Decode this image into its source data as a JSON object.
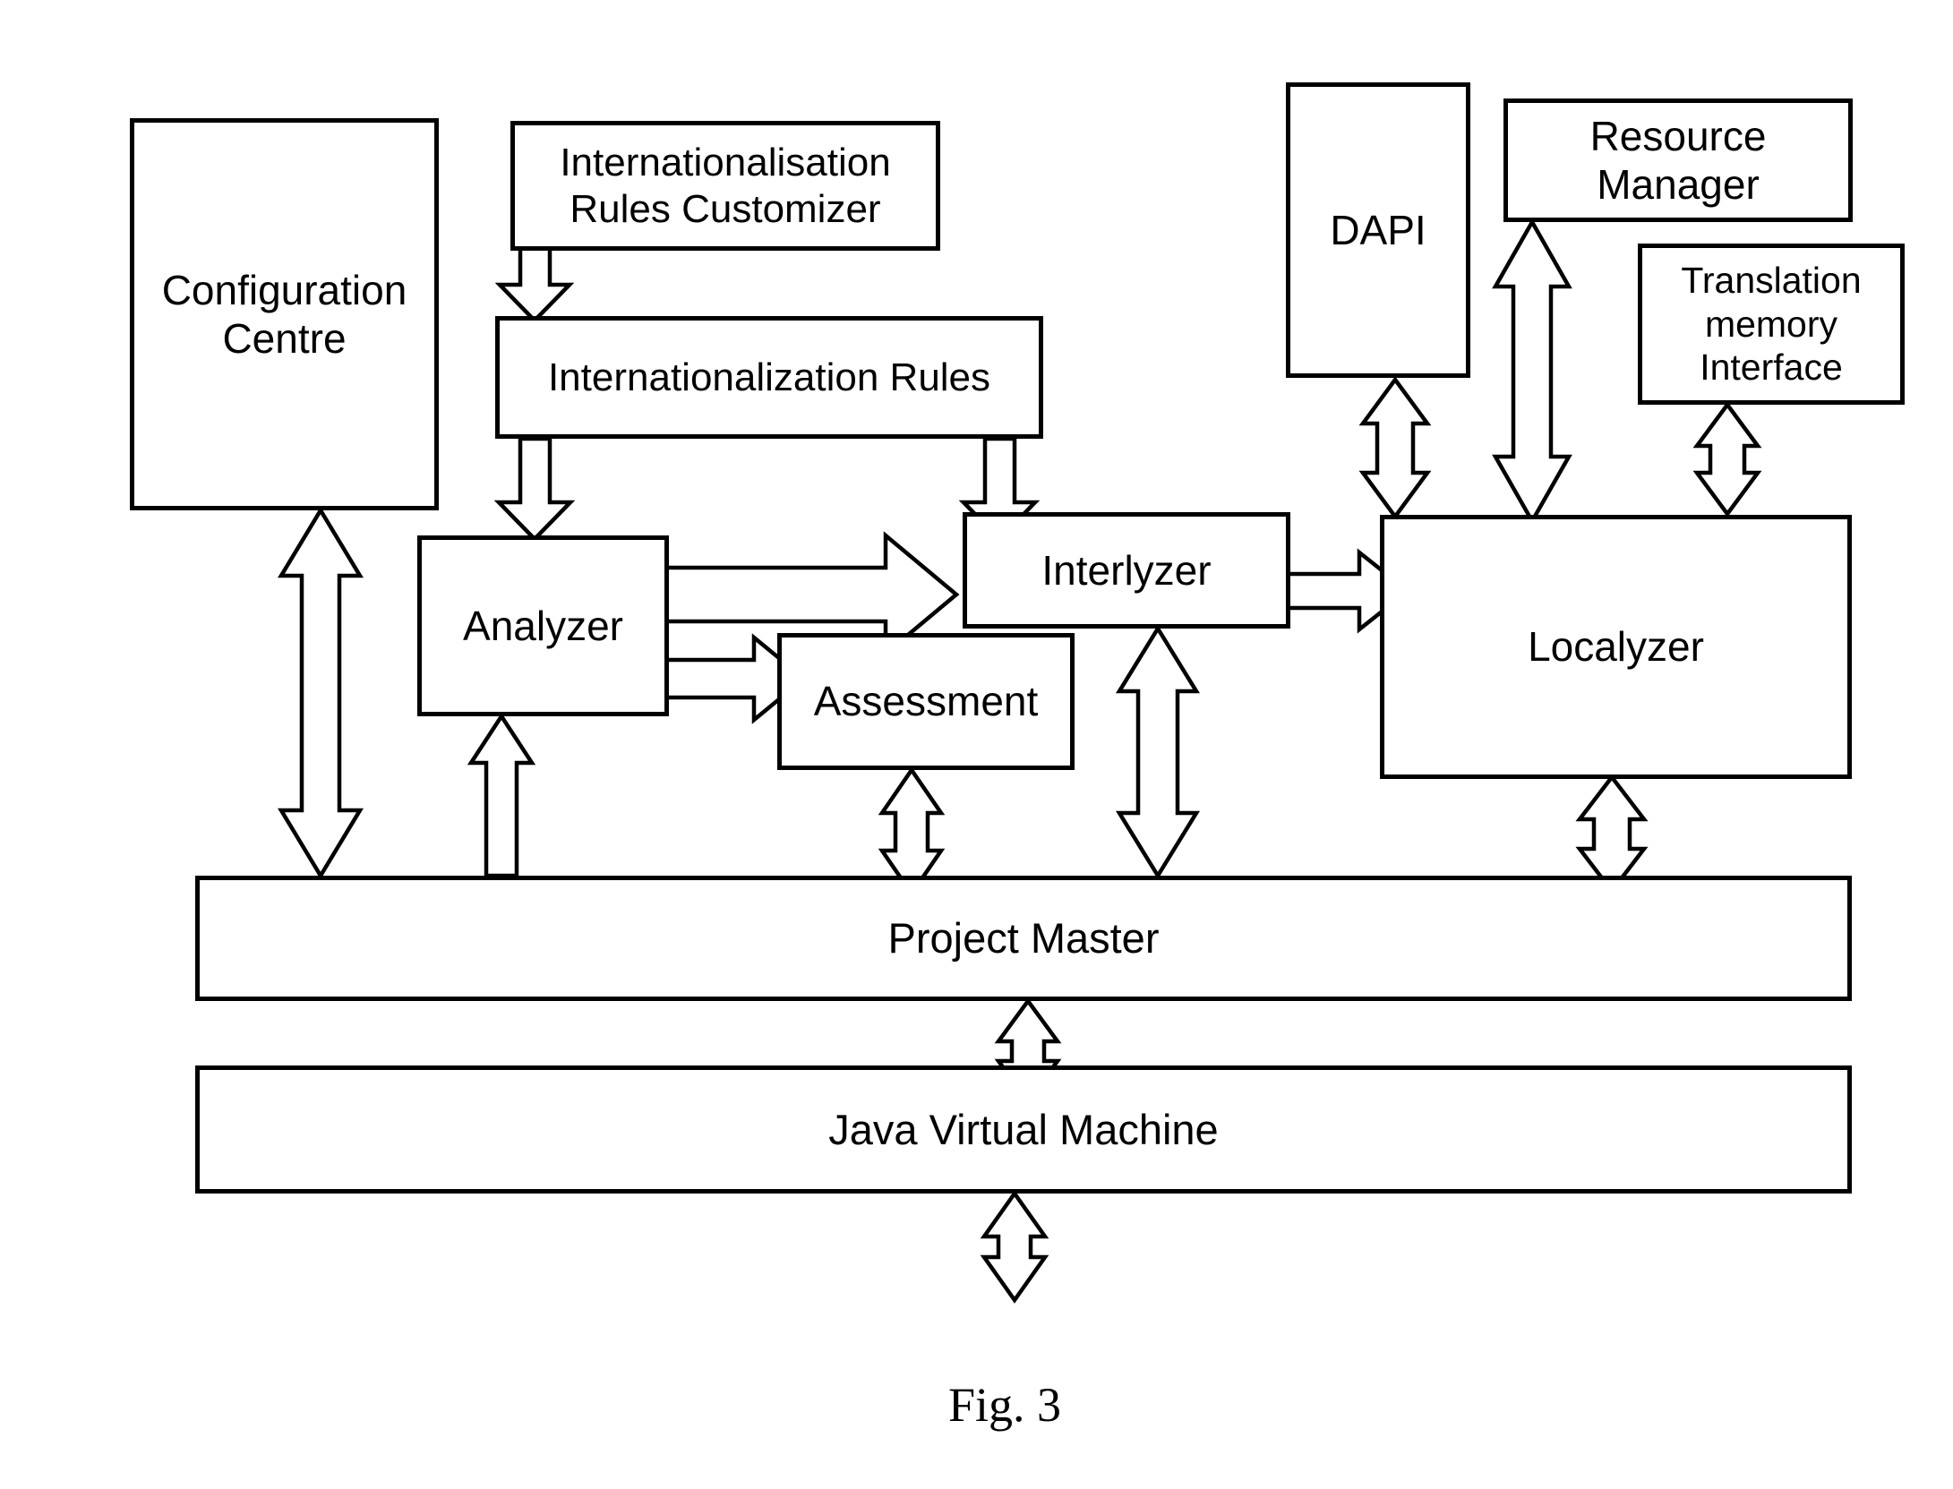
{
  "figure": {
    "caption": "Fig. 3",
    "type": "block-diagram"
  },
  "blocks": {
    "configuration_centre": "Configuration\nCentre",
    "i18n_rules_customizer": "Internationalisation\nRules Customizer",
    "i18n_rules": "Internationalization Rules",
    "analyzer": "Analyzer",
    "assessment": "Assessment",
    "interlyzer": "Interlyzer",
    "localyzer": "Localyzer",
    "dapi": "DAPI",
    "resource_manager": "Resource\nManager",
    "translation_memory_interface": "Translation\nmemory\nInterface",
    "project_master": "Project Master",
    "java_virtual_machine": "Java Virtual Machine"
  },
  "connections": [
    {
      "from": "i18n_rules_customizer",
      "to": "i18n_rules",
      "style": "single-down"
    },
    {
      "from": "i18n_rules",
      "to": "analyzer",
      "style": "single-down"
    },
    {
      "from": "i18n_rules",
      "to": "interlyzer",
      "style": "single-down"
    },
    {
      "from": "analyzer",
      "to": "interlyzer",
      "style": "single-right-wide"
    },
    {
      "from": "analyzer",
      "to": "assessment",
      "style": "single-right"
    },
    {
      "from": "interlyzer",
      "to": "localyzer",
      "style": "single-right"
    },
    {
      "from": "configuration_centre",
      "to": "project_master",
      "style": "double-vertical"
    },
    {
      "from": "project_master",
      "to": "analyzer",
      "style": "single-up"
    },
    {
      "from": "assessment",
      "to": "project_master",
      "style": "double-vertical"
    },
    {
      "from": "interlyzer",
      "to": "project_master",
      "style": "double-vertical"
    },
    {
      "from": "localyzer",
      "to": "project_master",
      "style": "double-vertical"
    },
    {
      "from": "dapi",
      "to": "localyzer",
      "style": "double-vertical"
    },
    {
      "from": "resource_manager",
      "to": "localyzer",
      "style": "double-vertical"
    },
    {
      "from": "translation_memory_interface",
      "to": "localyzer",
      "style": "double-vertical"
    },
    {
      "from": "project_master",
      "to": "java_virtual_machine",
      "style": "double-vertical"
    },
    {
      "from": "java_virtual_machine",
      "to": "operating-system",
      "style": "double-vertical-open"
    }
  ],
  "colors": {
    "stroke": "#000000",
    "fill": "#ffffff",
    "background": "#ffffff"
  }
}
